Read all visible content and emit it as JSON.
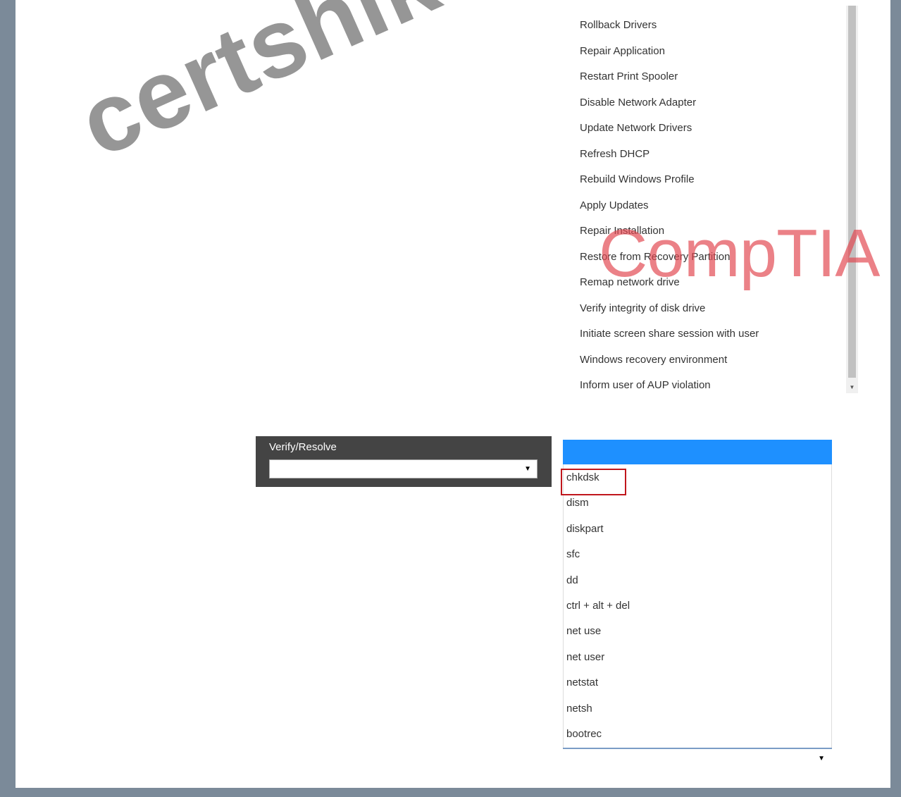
{
  "top_list": {
    "items": [
      "Rollback Drivers",
      "Repair Application",
      "Restart Print Spooler",
      "Disable Network Adapter",
      "Update Network Drivers",
      "Refresh DHCP",
      "Rebuild Windows Profile",
      "Apply Updates",
      "Repair Installation",
      "Restore from Recovery Partition",
      "Remap network drive",
      "Verify integrity of disk drive",
      "Initiate screen share session with user",
      "Windows recovery environment",
      "Inform user of AUP violation"
    ]
  },
  "verify_resolve": {
    "label": "Verify/Resolve",
    "selected_value": ""
  },
  "dropdown": {
    "highlighted_value": "",
    "options": [
      "chkdsk",
      "dism",
      "diskpart",
      "sfc",
      "dd",
      "ctrl + alt + del",
      "net use",
      "net user",
      "netstat",
      "netsh",
      "bootrec"
    ],
    "marked_option": "chkdsk",
    "selected_value": ""
  },
  "icons": {
    "select_arrow": "▼",
    "scroll_down": "▼"
  },
  "colors": {
    "highlight": "#1e90ff",
    "marker": "#c0161c",
    "frame": "#7b8a99"
  },
  "watermarks": {
    "certshiken": "certshiken.co",
    "comptia": "CompTIA"
  }
}
